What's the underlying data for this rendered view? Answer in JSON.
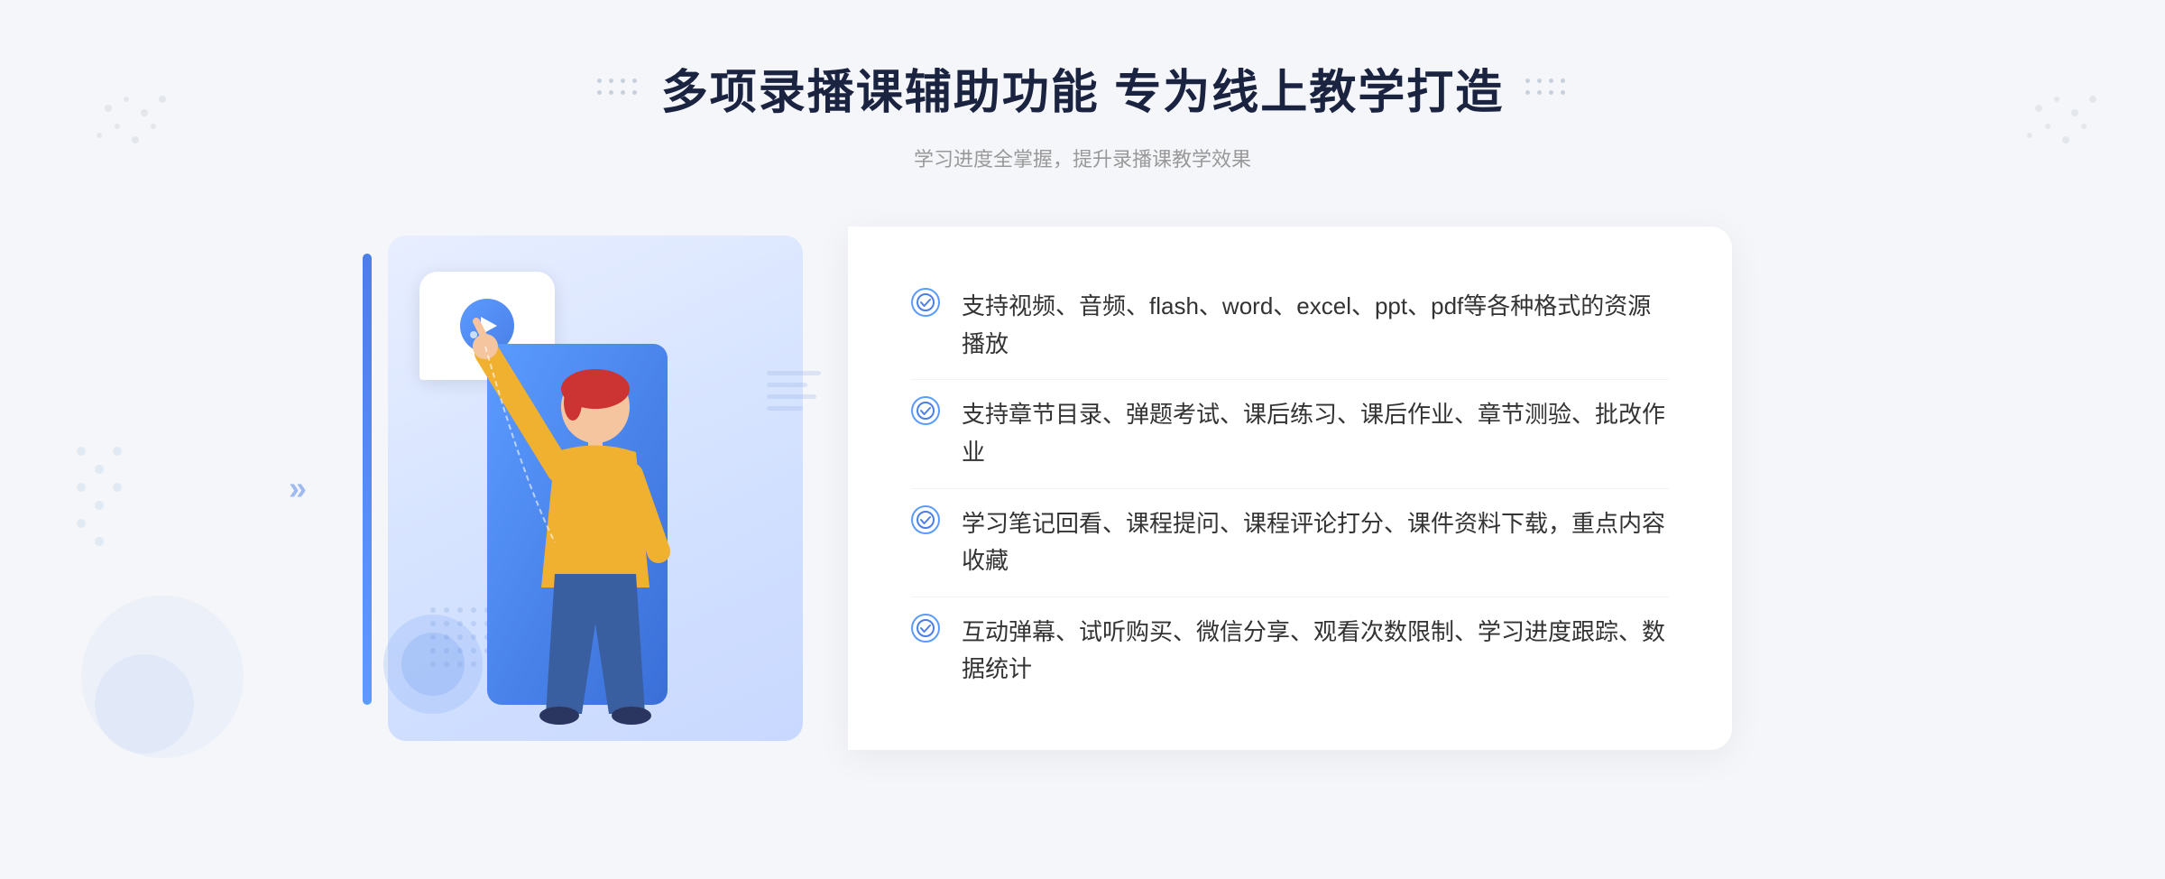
{
  "header": {
    "title": "多项录播课辅助功能 专为线上教学打造",
    "subtitle": "学习进度全掌握，提升录播课教学效果"
  },
  "features": [
    {
      "id": 1,
      "text": "支持视频、音频、flash、word、excel、ppt、pdf等各种格式的资源播放"
    },
    {
      "id": 2,
      "text": "支持章节目录、弹题考试、课后练习、课后作业、章节测验、批改作业"
    },
    {
      "id": 3,
      "text": "学习笔记回看、课程提问、课程评论打分、课件资料下载，重点内容收藏"
    },
    {
      "id": 4,
      "text": "互动弹幕、试听购买、微信分享、观看次数限制、学习进度跟踪、数据统计"
    }
  ],
  "decorators": {
    "left_arrows": "»",
    "check_symbol": "✓"
  },
  "colors": {
    "primary": "#4a7fe8",
    "primary_light": "#5b9bff",
    "text_dark": "#1a2340",
    "text_gray": "#999",
    "text_body": "#333"
  }
}
